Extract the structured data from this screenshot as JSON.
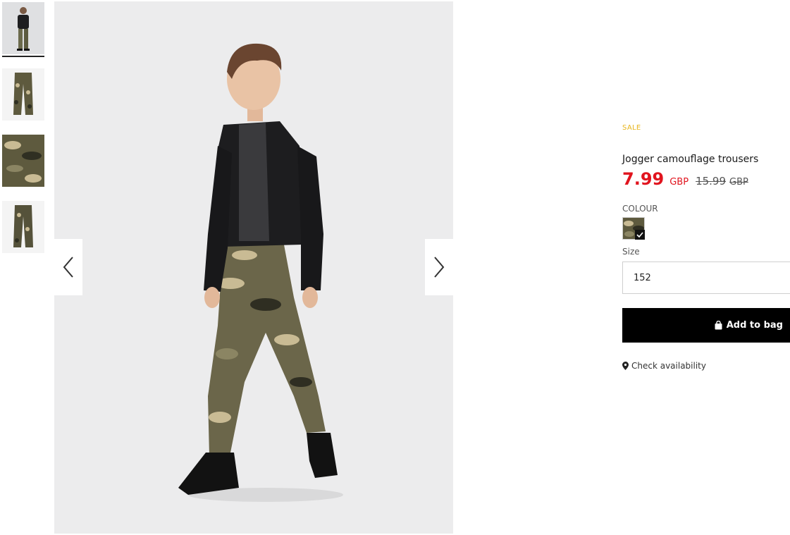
{
  "product": {
    "badge": "SALE",
    "title": "Jogger camouflage trousers",
    "price": {
      "current": "7.99",
      "current_currency": "GBP",
      "old": "15.99",
      "old_currency": "GBP"
    },
    "colour_label": "COLOUR",
    "size_label": "Size",
    "size_value": "152",
    "add_to_bag_label": "Add to bag",
    "check_availability_label": "Check availability"
  },
  "gallery": {
    "thumbnail_count": 4,
    "active_thumbnail": 1
  },
  "colors": {
    "sale_badge": "#e8b51b",
    "price": "#e1141e",
    "button_bg": "#000000"
  },
  "icons": [
    "chevron-left-icon",
    "chevron-right-icon",
    "bag-icon",
    "location-pin-icon",
    "check-icon"
  ]
}
